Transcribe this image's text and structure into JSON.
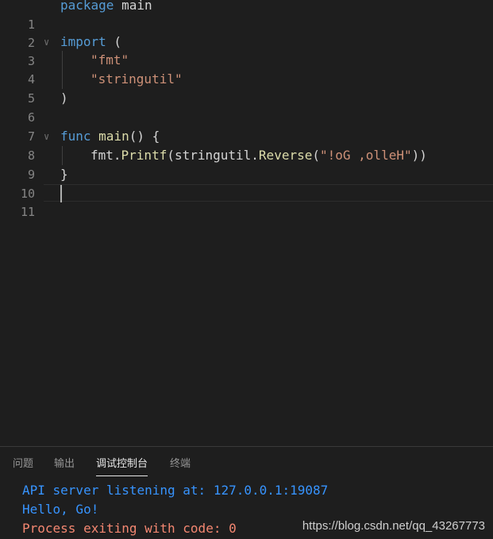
{
  "editor": {
    "line_numbers": [
      "1",
      "2",
      "3",
      "4",
      "5",
      "6",
      "7",
      "8",
      "9",
      "10",
      "11"
    ],
    "line1": {
      "kw": "package",
      "rest": " main"
    },
    "line3": {
      "kw": "import",
      "rest": " ("
    },
    "line4": {
      "str": "\"fmt\""
    },
    "line5": {
      "str": "\"stringutil\""
    },
    "line6": {
      "text": ")"
    },
    "line8": {
      "kw": "func",
      "sp": " ",
      "fn": "main",
      "rest": "() {"
    },
    "line9": {
      "pkg1": "fmt.",
      "fn1": "Printf",
      "p1": "(stringutil.",
      "fn2": "Reverse",
      "p2": "(",
      "str": "\"!oG ,olleH\"",
      "p3": "))"
    },
    "line10": {
      "text": "}"
    }
  },
  "panel": {
    "tabs": [
      "问题",
      "输出",
      "调试控制台",
      "终端"
    ],
    "active_tab": "调试控制台",
    "console": [
      {
        "text": "API server listening at: 127.0.0.1:19087",
        "color": "#3794ff"
      },
      {
        "text": "Hello, Go!",
        "color": "#3794ff"
      },
      {
        "text": "Process exiting with code: 0",
        "color": "#f48771"
      }
    ]
  },
  "watermark": "https://blog.csdn.net/qq_43267773",
  "colors": {
    "background": "#1e1e1e",
    "keyword": "#569cd6",
    "function": "#dcdcaa",
    "string": "#ce9178",
    "line_number": "#858585"
  }
}
